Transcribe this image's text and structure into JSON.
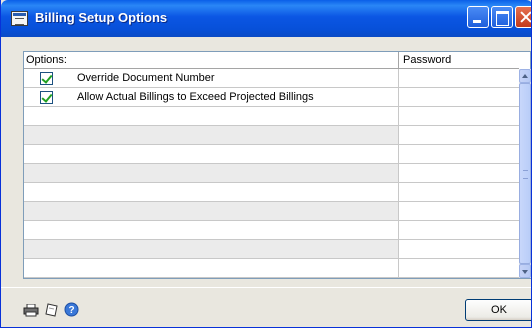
{
  "window": {
    "title": "Billing Setup Options"
  },
  "grid": {
    "columns": {
      "options": "Options:",
      "password": "Password"
    },
    "rows": [
      {
        "checked": true,
        "label": "Override Document Number",
        "password": ""
      },
      {
        "checked": true,
        "label": "Allow Actual Billings to Exceed Projected Billings",
        "password": ""
      },
      {
        "checked": false,
        "label": "",
        "password": ""
      },
      {
        "checked": false,
        "label": "",
        "password": ""
      },
      {
        "checked": false,
        "label": "",
        "password": ""
      },
      {
        "checked": false,
        "label": "",
        "password": ""
      },
      {
        "checked": false,
        "label": "",
        "password": ""
      },
      {
        "checked": false,
        "label": "",
        "password": ""
      },
      {
        "checked": false,
        "label": "",
        "password": ""
      },
      {
        "checked": false,
        "label": "",
        "password": ""
      },
      {
        "checked": false,
        "label": "",
        "password": ""
      }
    ]
  },
  "footer": {
    "icons": [
      "printer-icon",
      "note-icon",
      "help-icon"
    ],
    "ok_label": "OK"
  },
  "colors": {
    "titlebar": "#0b56e4",
    "window_bg": "#e9e7df",
    "check": "#21a121"
  }
}
